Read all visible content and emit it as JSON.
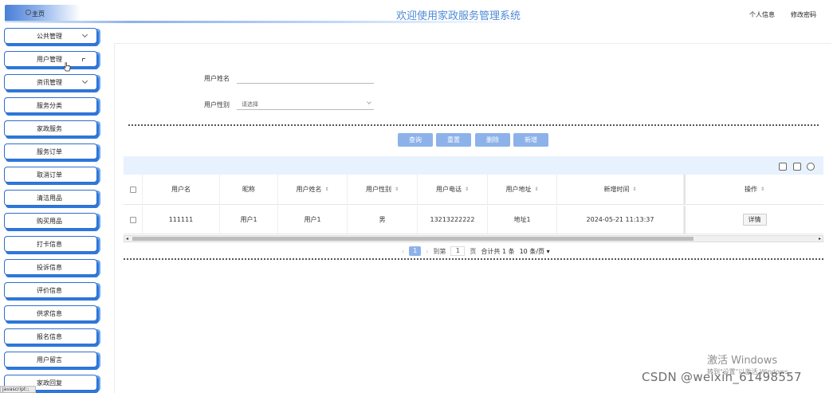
{
  "header": {
    "home_label": "主页",
    "title": "欢迎使用家政服务管理系统",
    "links": [
      "个人信息",
      "修改密码"
    ]
  },
  "sidebar": {
    "items": [
      {
        "label": "公共管理",
        "has_chevron": true
      },
      {
        "label": "用户管理",
        "has_chevron": false
      },
      {
        "label": "资讯管理",
        "has_chevron": true
      },
      {
        "label": "服务分类"
      },
      {
        "label": "家政服务"
      },
      {
        "label": "服务订单"
      },
      {
        "label": "取消订单"
      },
      {
        "label": "清洁用品"
      },
      {
        "label": "购买用品"
      },
      {
        "label": "打卡信息"
      },
      {
        "label": "投诉信息"
      },
      {
        "label": "评价信息"
      },
      {
        "label": "供求信息"
      },
      {
        "label": "报名信息"
      },
      {
        "label": "用户留言"
      },
      {
        "label": "家政回复"
      }
    ]
  },
  "search": {
    "name_label": "用户姓名",
    "name_value": "",
    "gender_label": "用户性别",
    "gender_placeholder": "请选择"
  },
  "buttons": {
    "query": "查询",
    "reset": "重置",
    "delete": "删除",
    "add": "新增"
  },
  "table": {
    "columns": [
      "用户名",
      "昵称",
      "用户姓名",
      "用户性别",
      "用户电话",
      "用户地址",
      "新增时间",
      "操作"
    ],
    "rows": [
      {
        "username": "111111",
        "nickname": "用户1",
        "realname": "用户1",
        "gender": "男",
        "phone": "13213222222",
        "address": "地址1",
        "created": "2024-05-21 11:13:37",
        "action": "详情"
      }
    ]
  },
  "pagination": {
    "current_page": "1",
    "goto_label": "到第",
    "goto_value": "1",
    "page_unit": "页",
    "total_text": "合计共 1 条",
    "page_size": "10 条/页"
  },
  "statusbar": "javascript:;",
  "watermark": {
    "line1": "激活 Windows",
    "line2": "转到\"设置\"以激活 Windows。",
    "csdn": "CSDN @weixin_61498557"
  }
}
